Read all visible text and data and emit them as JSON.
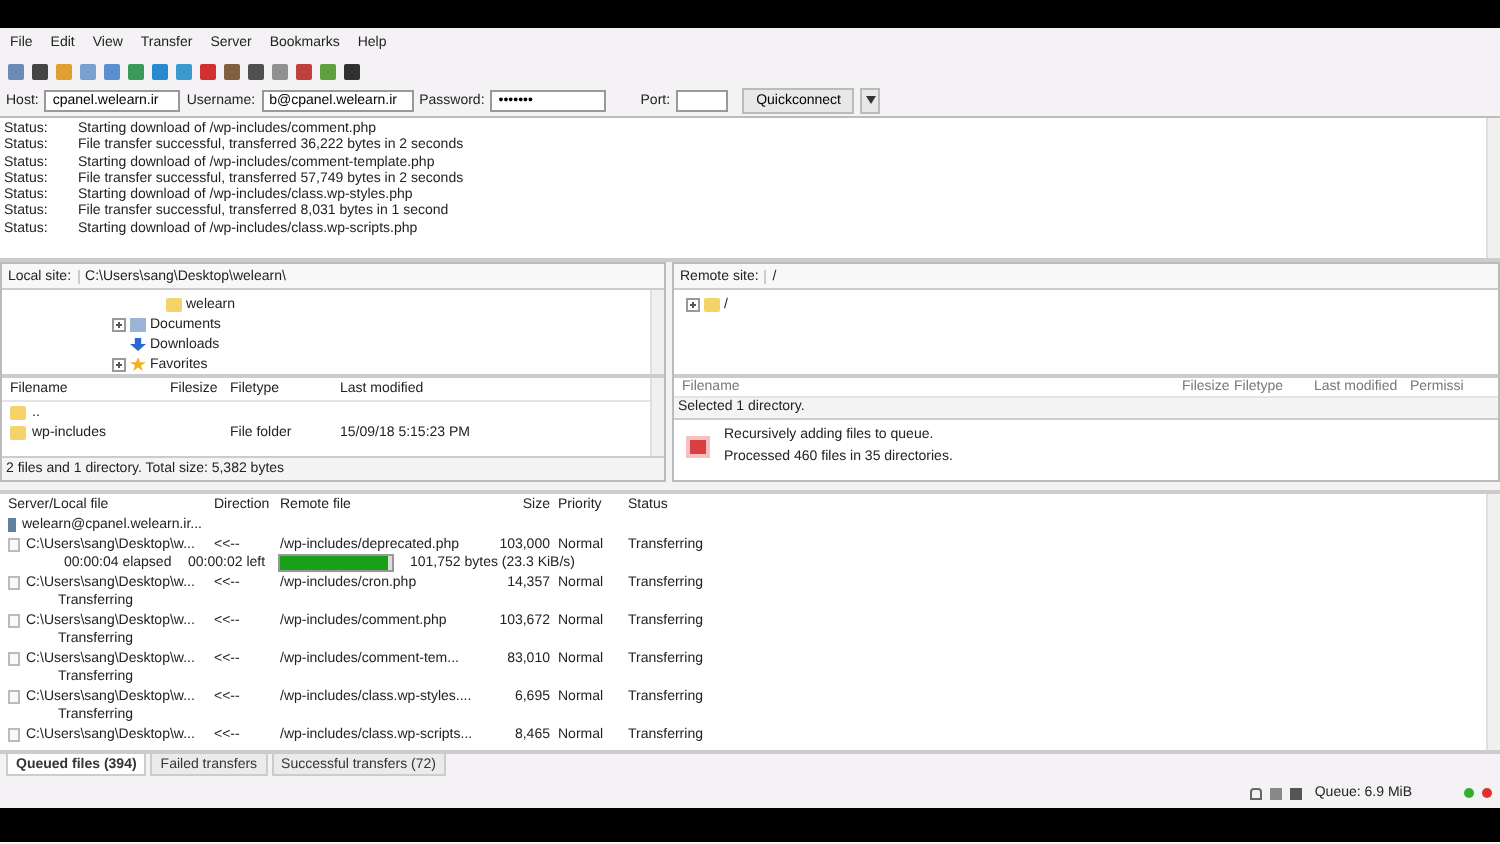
{
  "menu": [
    "File",
    "Edit",
    "View",
    "Transfer",
    "Server",
    "Bookmarks",
    "Help"
  ],
  "quickconnect": {
    "host_label": "Host:",
    "host": "cpanel.welearn.ir",
    "username_label": "Username:",
    "username": "b@cpanel.welearn.ir",
    "password_label": "Password:",
    "password": "•••••••",
    "port_label": "Port:",
    "button": "Quickconnect"
  },
  "log": [
    {
      "label": "Status:",
      "message": "Starting download of /wp-includes/comment.php"
    },
    {
      "label": "Status:",
      "message": "File transfer successful, transferred 36,222 bytes in 2 seconds"
    },
    {
      "label": "Status:",
      "message": "Starting download of /wp-includes/comment-template.php"
    },
    {
      "label": "Status:",
      "message": "File transfer successful, transferred 57,749 bytes in 2 seconds"
    },
    {
      "label": "Status:",
      "message": "Starting download of /wp-includes/class.wp-styles.php"
    },
    {
      "label": "Status:",
      "message": "File transfer successful, transferred 8,031 bytes in 1 second"
    },
    {
      "label": "Status:",
      "message": "Starting download of /wp-includes/class.wp-scripts.php"
    }
  ],
  "local": {
    "label": "Local site:",
    "path": "C:\\Users\\sang\\Desktop\\welearn\\",
    "tree": [
      {
        "name": "welearn",
        "kind": "folder",
        "expandable": false
      },
      {
        "name": "Documents",
        "kind": "documents",
        "expandable": true
      },
      {
        "name": "Downloads",
        "kind": "downloads",
        "expandable": false
      },
      {
        "name": "Favorites",
        "kind": "favorites",
        "expandable": true
      }
    ],
    "columns": [
      "Filename",
      "Filesize",
      "Filetype",
      "Last modified"
    ],
    "rows": [
      {
        "name": "..",
        "size": "",
        "type": "",
        "modified": ""
      },
      {
        "name": "wp-includes",
        "size": "",
        "type": "File folder",
        "modified": "15/09/18 5:15:23 PM"
      }
    ],
    "status": "2 files and 1 directory. Total size: 5,382 bytes"
  },
  "remote": {
    "label": "Remote site:",
    "path": "/",
    "tree": [
      {
        "name": "/",
        "kind": "folder",
        "expandable": true
      }
    ],
    "columns": [
      "Filename",
      "Filesize",
      "Filetype",
      "Last modified",
      "Permissi"
    ],
    "status": "Selected 1 directory.",
    "messages": [
      "Recursively adding files to queue.",
      "Processed 460 files in 35 directories."
    ]
  },
  "queue": {
    "columns": [
      "Server/Local file",
      "Direction",
      "Remote file",
      "Size",
      "Priority",
      "Status"
    ],
    "server": "welearn@cpanel.welearn.ir...",
    "items": [
      {
        "local": "C:\\Users\\sang\\Desktop\\w...",
        "direction": "<<--",
        "remote": "/wp-includes/deprecated.php",
        "size": "103,000",
        "priority": "Normal",
        "status": "Transferring",
        "progress": {
          "elapsed": "00:00:04 elapsed",
          "left": "00:00:02 left",
          "level": 0.97,
          "bytes": "101,752 bytes (23.3 KiB/s)"
        }
      },
      {
        "local": "C:\\Users\\sang\\Desktop\\w...",
        "direction": "<<--",
        "remote": "/wp-includes/cron.php",
        "size": "14,357",
        "priority": "Normal",
        "status": "Transferring",
        "sub_status": "Transferring"
      },
      {
        "local": "C:\\Users\\sang\\Desktop\\w...",
        "direction": "<<--",
        "remote": "/wp-includes/comment.php",
        "size": "103,672",
        "priority": "Normal",
        "status": "Transferring",
        "sub_status": "Transferring"
      },
      {
        "local": "C:\\Users\\sang\\Desktop\\w...",
        "direction": "<<--",
        "remote": "/wp-includes/comment-tem...",
        "size": "83,010",
        "priority": "Normal",
        "status": "Transferring",
        "sub_status": "Transferring"
      },
      {
        "local": "C:\\Users\\sang\\Desktop\\w...",
        "direction": "<<--",
        "remote": "/wp-includes/class.wp-styles....",
        "size": "6,695",
        "priority": "Normal",
        "status": "Transferring",
        "sub_status": "Transferring"
      },
      {
        "local": "C:\\Users\\sang\\Desktop\\w...",
        "direction": "<<--",
        "remote": "/wp-includes/class.wp-scripts...",
        "size": "8,465",
        "priority": "Normal",
        "status": "Transferring"
      }
    ],
    "tabs": [
      {
        "label": "Queued files (394)",
        "selected": true
      },
      {
        "label": "Failed transfers",
        "selected": false
      },
      {
        "label": "Successful transfers (72)",
        "selected": false
      }
    ]
  },
  "status_bar": {
    "queue": "Queue: 6.9 MiB"
  }
}
